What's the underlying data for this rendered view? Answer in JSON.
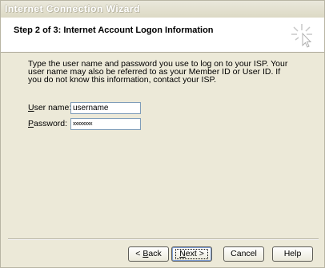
{
  "window": {
    "title": "Internet Connection Wizard"
  },
  "header": {
    "step_title": "Step 2 of 3: Internet Account Logon Information"
  },
  "main": {
    "description": "Type the user name and password you use to log on to your ISP. Your user name may also be referred to as your Member ID or User ID. If you do not know this information, contact your ISP.",
    "username": {
      "label_mnemonic": "U",
      "label_rest": "ser name:",
      "value": "username"
    },
    "password": {
      "label_mnemonic": "P",
      "label_rest": "assword:",
      "value": "xxxxxxxx"
    }
  },
  "buttons": {
    "back": {
      "prefix": "< ",
      "mnemonic": "B",
      "rest": "ack"
    },
    "next": {
      "mnemonic": "N",
      "rest": "ext >"
    },
    "cancel": "Cancel",
    "help": "Help"
  }
}
